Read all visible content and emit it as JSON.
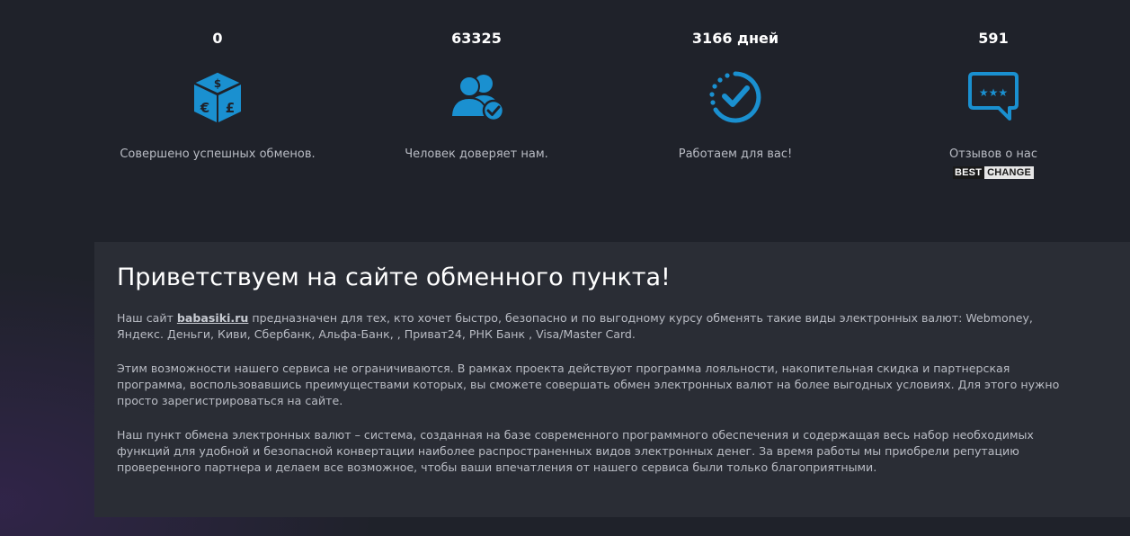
{
  "colors": {
    "accent": "#1a90d0",
    "background": "#1f222a",
    "panel": "#2a2d35",
    "text": "#b9bcc4"
  },
  "stats": [
    {
      "value": "0",
      "icon": "currency-cube-icon",
      "caption": "Совершено успешных обменов."
    },
    {
      "value": "63325",
      "icon": "users-check-icon",
      "caption": "Человек доверяет нам."
    },
    {
      "value": "3166 дней",
      "icon": "clock-check-icon",
      "caption": "Работаем для вас!"
    },
    {
      "value": "591",
      "icon": "review-bubble-icon",
      "caption": "Отзывов о нас"
    }
  ],
  "bestchange": {
    "part1": "BEST",
    "part2": "CHANGE"
  },
  "welcome": {
    "title": "Приветствуем на сайте обменного пункта!",
    "p1_before": "Наш сайт ",
    "p1_link": "babasiki.ru",
    "p1_after": " предназначен для тех, кто хочет быстро, безопасно и по выгодному курсу обменять такие виды электронных валют: Webmoney, Яндекс. Деньги, Киви, Сбербанк,  Альфа-Банк, , Приват24, РНК Банк , Visa/Master Card.",
    "p2": "Этим возможности нашего сервиса не ограничиваются. В рамках проекта действуют программа лояльности, накопительная скидка и партнерская программа, воспользовавшись преимуществами которых, вы сможете совершать обмен электронных валют на более выгодных условиях. Для этого нужно просто зарегистрироваться на сайте.",
    "p3": "Наш пункт обмена электронных валют – система, созданная на базе современного программного обеспечения и содержащая весь набор необходимых функций для удобной и безопасной конвертации наиболее распространенных видов электронных денег. За время работы мы приобрели репутацию проверенного партнера и делаем все возможное, чтобы ваши впечатления от нашего сервиса были только благоприятными."
  }
}
